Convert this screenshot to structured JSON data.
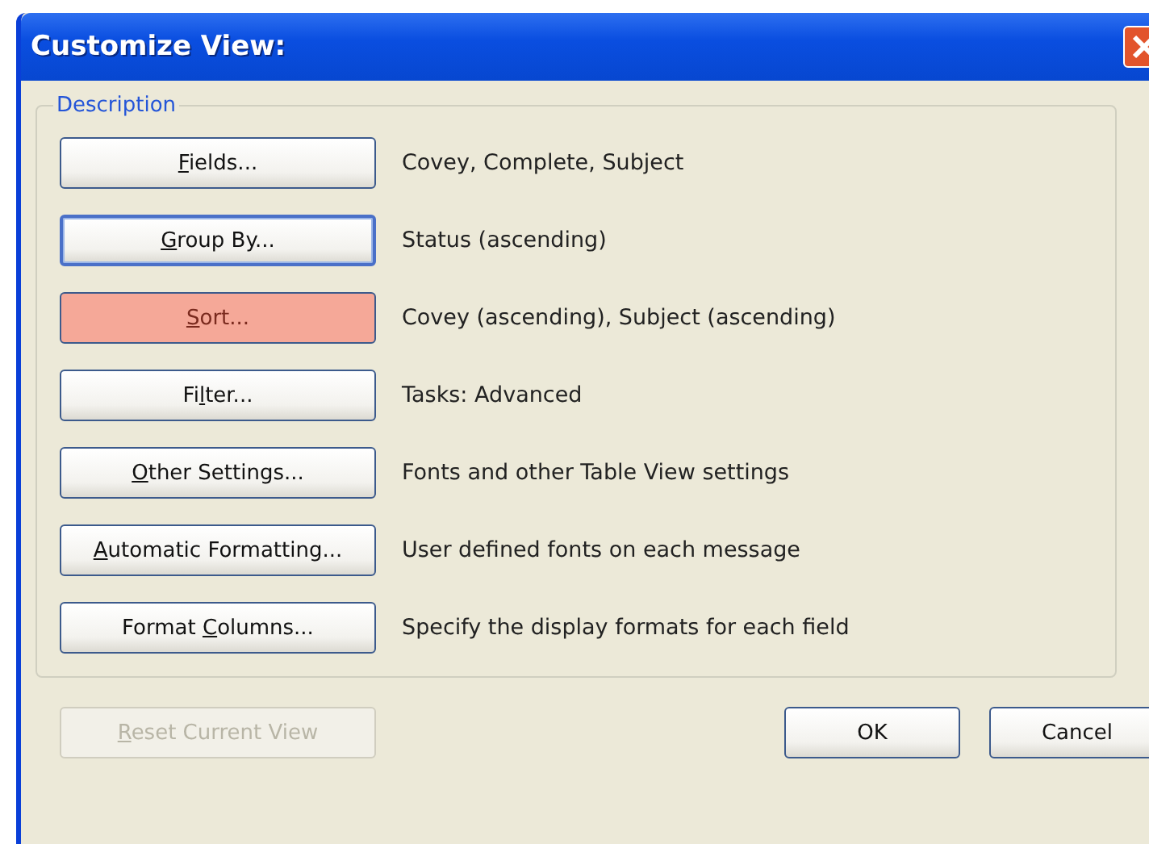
{
  "window": {
    "title": "Customize View:"
  },
  "group": {
    "title": "Description",
    "rows": [
      {
        "button": {
          "key": "F",
          "post": "ields..."
        },
        "focused": false,
        "highlighted": false,
        "description": "Covey, Complete, Subject"
      },
      {
        "button": {
          "key": "G",
          "post": "roup By..."
        },
        "focused": true,
        "highlighted": false,
        "description": "Status (ascending)"
      },
      {
        "button": {
          "key": "S",
          "post": "ort..."
        },
        "focused": false,
        "highlighted": true,
        "description": "Covey (ascending), Subject (ascending)"
      },
      {
        "button": {
          "pre": "Fi",
          "key": "l",
          "post": "ter..."
        },
        "focused": false,
        "highlighted": false,
        "description": "Tasks: Advanced"
      },
      {
        "button": {
          "key": "O",
          "post": "ther Settings..."
        },
        "focused": false,
        "highlighted": false,
        "description": "Fonts and other Table View settings"
      },
      {
        "button": {
          "key": "A",
          "post": "utomatic Formatting..."
        },
        "focused": false,
        "highlighted": false,
        "description": "User defined fonts on each message"
      },
      {
        "button": {
          "pre": "Format ",
          "key": "C",
          "post": "olumns..."
        },
        "focused": false,
        "highlighted": false,
        "description": "Specify the display formats for each field"
      }
    ]
  },
  "reset_button": {
    "key": "R",
    "post": "eset Current View",
    "disabled": true
  },
  "ok_button": "OK",
  "cancel_button": "Cancel"
}
